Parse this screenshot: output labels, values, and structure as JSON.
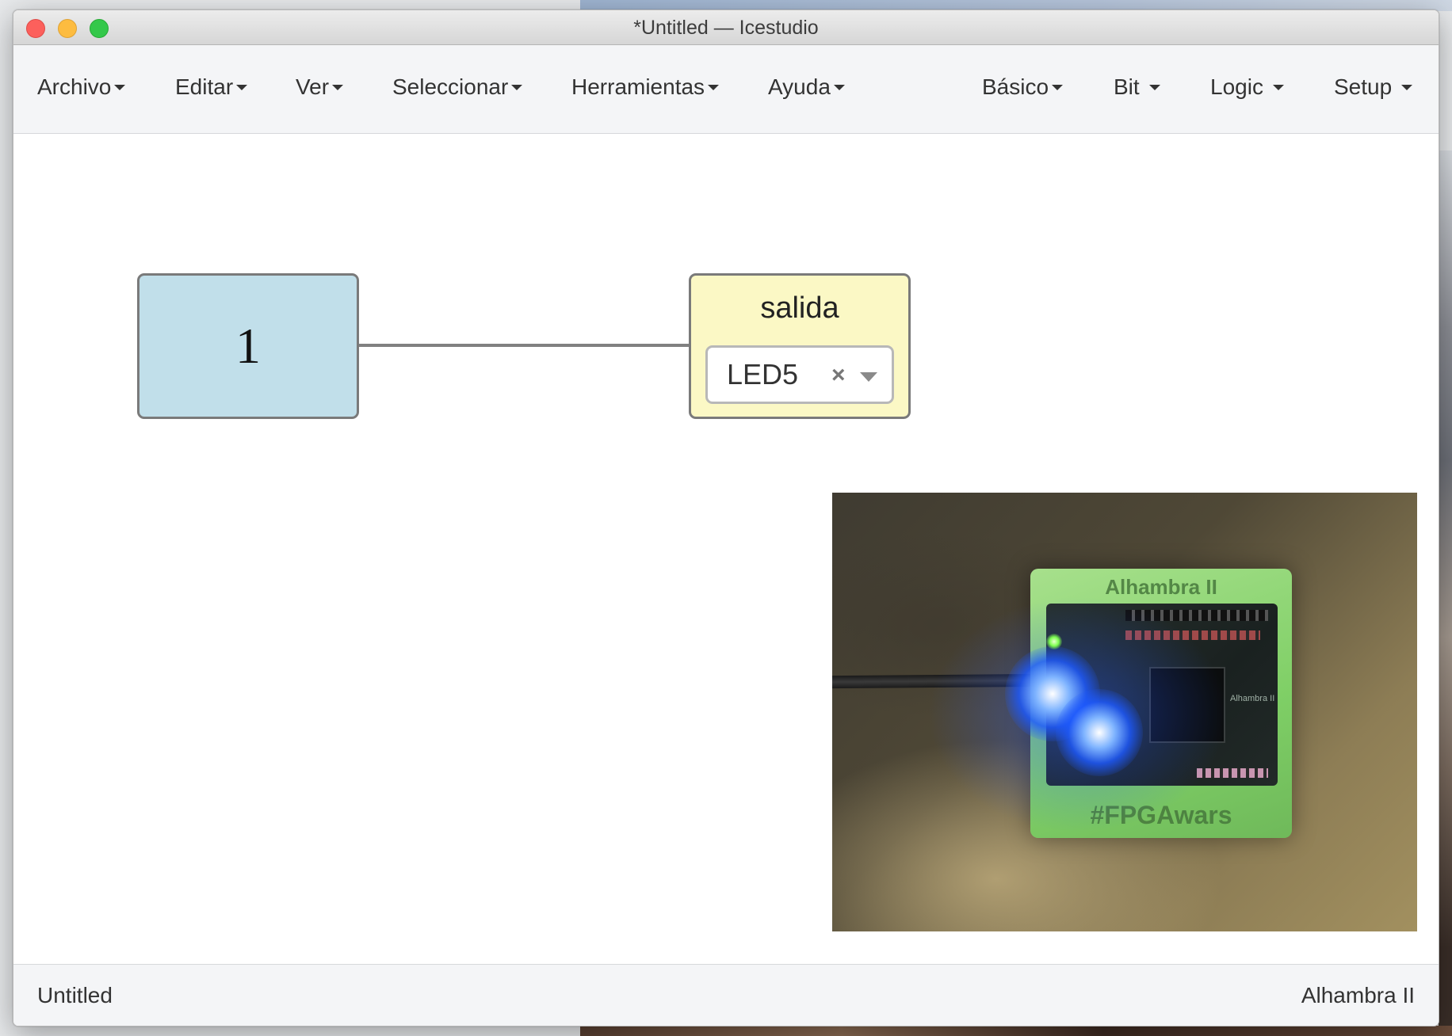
{
  "window": {
    "title": "*Untitled — Icestudio"
  },
  "menubar": {
    "left_menus": [
      {
        "label": "Archivo"
      },
      {
        "label": "Editar"
      },
      {
        "label": "Ver"
      },
      {
        "label": "Seleccionar"
      },
      {
        "label": "Herramientas"
      },
      {
        "label": "Ayuda"
      }
    ],
    "right_menus": [
      {
        "label": "Básico"
      },
      {
        "label": "Bit"
      },
      {
        "label": "Logic"
      },
      {
        "label": "Setup"
      }
    ]
  },
  "canvas": {
    "constant_block": {
      "value": "1"
    },
    "output_block": {
      "label": "salida",
      "pin": {
        "selected": "LED5",
        "clear_symbol": "×"
      }
    },
    "photo": {
      "description_icon": "board-photo",
      "case_top_text": "Alhambra II",
      "case_bottom_text": "#FPGAwars",
      "pcb_text": "Alhambra II"
    }
  },
  "statusbar": {
    "project_name": "Untitled",
    "board_name": "Alhambra II"
  },
  "colors": {
    "constant_block_bg": "#c1dfea",
    "output_block_bg": "#fbf8c5",
    "wire": "#808080",
    "menubar_bg": "#f4f5f7"
  }
}
